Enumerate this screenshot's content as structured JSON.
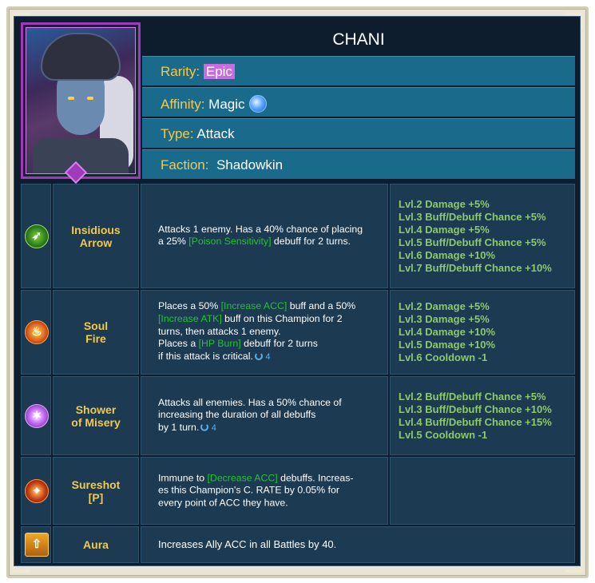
{
  "champion": {
    "name": "CHANI",
    "rarity_label": "Rarity:",
    "rarity": "Epic",
    "affinity_label": "Affinity:",
    "affinity": "Magic",
    "affinity_icon": "magic-affinity-icon",
    "type_label": "Type:",
    "type": "Attack",
    "faction_label": "Faction:",
    "faction": "Shadowkin"
  },
  "colors": {
    "gold": "#f2c94c",
    "epic": "#c86ae0",
    "buff_green": "#22c42e",
    "bonus_green": "#8ec96a",
    "panel": "#1c3a52",
    "header": "#1a6a8c"
  },
  "skills": [
    {
      "icon": "arrow-skill-icon",
      "name_line1": "Insidious",
      "name_line2": "Arrow",
      "desc": {
        "t1": "Attacks 1 enemy. Has a 40% chance of placing",
        "t2": "a 25% ",
        "h1": "[Poison Sensitivity]",
        "t3": " debuff for 2 turns."
      },
      "bonuses": [
        "Lvl.2 Damage +5%",
        "Lvl.3 Buff/Debuff Chance +5%",
        "Lvl.4 Damage +5%",
        "Lvl.5 Buff/Debuff Chance +5%",
        "Lvl.6 Damage +10%",
        "Lvl.7 Buff/Debuff Chance +10%"
      ]
    },
    {
      "icon": "fire-skill-icon",
      "name_line1": "Soul",
      "name_line2": "Fire",
      "desc": {
        "t1": "Places a 50% ",
        "h1": "[Increase ACC]",
        "t2": " buff and a 50%",
        "h2": "[Increase ATK]",
        "t3": " buff on this Champion for 2",
        "t4": "turns, then attacks 1 enemy.",
        "t5": "Places a ",
        "h3": "[HP Burn]",
        "t6": " debuff for 2 turns",
        "t7": "if this attack is critical.",
        "cooldown": "4"
      },
      "bonuses": [
        "Lvl.2 Damage +5%",
        "Lvl.3 Damage +5%",
        "Lvl.4 Damage +10%",
        "Lvl.5 Damage +10%",
        "Lvl.6 Cooldown -1"
      ]
    },
    {
      "icon": "misery-skill-icon",
      "name_line1": "Shower",
      "name_line2": "of Misery",
      "desc": {
        "t1": "Attacks all enemies. Has a 50% chance of",
        "t2": "increasing the duration of all debuffs",
        "t3": "by 1 turn.",
        "cooldown": "4"
      },
      "bonuses": [
        "Lvl.2 Buff/Debuff Chance +5%",
        "Lvl.3 Buff/Debuff Chance +10%",
        "Lvl.4 Buff/Debuff Chance +15%",
        "Lvl.5 Cooldown -1"
      ]
    },
    {
      "icon": "sureshot-skill-icon",
      "name_line1": "Sureshot",
      "name_line2": "[P]",
      "desc": {
        "t1": "Immune to ",
        "h1": "[Decrease ACC]",
        "t2": " debuffs. Increas-",
        "t3": "es this Champion's C. RATE by 0.05% for",
        "t4": "every point of ACC they have."
      },
      "bonuses": []
    }
  ],
  "aura": {
    "icon": "aura-arrow-icon",
    "name": "Aura",
    "desc": "Increases Ally ACC in all Battles by 40."
  }
}
